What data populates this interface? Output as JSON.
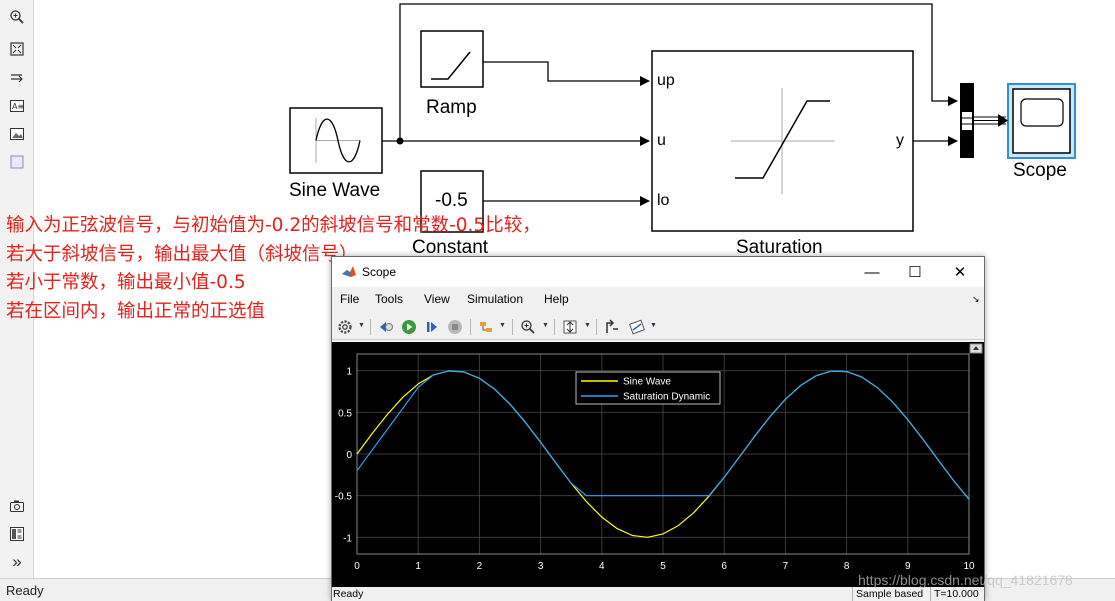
{
  "palette": {
    "items": [
      "zoom-icon",
      "fit-view-icon",
      "route-lines-icon",
      "annotation-icon",
      "image-icon",
      "area-icon"
    ],
    "bottom_items": [
      "camera-icon",
      "model-browser-icon",
      "expand-icon"
    ],
    "expand_glyph": "»"
  },
  "diagram": {
    "blocks": {
      "sine_wave": "Sine Wave",
      "ramp": "Ramp",
      "constant": "Constant",
      "constant_value": "-0.5",
      "saturation": "Saturation",
      "scope": "Scope"
    },
    "ports": {
      "up": "up",
      "u": "u",
      "lo": "lo",
      "y": "y"
    }
  },
  "annotation": {
    "lines": [
      "输入为正弦波信号，与初始值为-0.2的斜坡信号和常数-0.5比较，",
      "若大于斜坡信号，输出最大值（斜坡信号）",
      "若小于常数，输出最小值-0.5",
      "若在区间内，输出正常的正选值"
    ]
  },
  "status": {
    "text": "Ready"
  },
  "scope_window": {
    "title": "Scope",
    "controls": {
      "minimize": "—",
      "maximize": "☐",
      "close": "✕"
    },
    "menu": [
      "File",
      "Tools",
      "View",
      "Simulation",
      "Help"
    ],
    "toolbar": [
      "settings-icon",
      "step-back-icon",
      "run-icon",
      "step-forward-icon",
      "stop-icon",
      "highlight-icon",
      "zoom-icon",
      "autoscale-icon",
      "triggers-icon",
      "measurements-icon"
    ],
    "status": {
      "ready": "Ready",
      "sample": "Sample based",
      "time": "T=10.000"
    },
    "colors": {
      "sine": "#ffff00",
      "saturation": "#2fa2ff",
      "background": "#000000",
      "axes": "#ffffff"
    }
  },
  "chart_data": {
    "type": "line",
    "title": "",
    "xlabel": "",
    "ylabel": "",
    "xlim": [
      0,
      10
    ],
    "ylim": [
      -1.2,
      1.2
    ],
    "xticks": [
      0,
      1,
      2,
      3,
      4,
      5,
      6,
      7,
      8,
      9,
      10
    ],
    "yticks": [
      -1,
      -0.5,
      0,
      0.5,
      1
    ],
    "ytick_labels": [
      "-1",
      "-0.5",
      "0",
      "0.5",
      "1"
    ],
    "grid": true,
    "legend": "top-center",
    "series": [
      {
        "name": "Sine Wave",
        "color": "#ffff00",
        "x": [
          0,
          0.25,
          0.5,
          0.75,
          1,
          1.25,
          1.5,
          1.75,
          2,
          2.25,
          2.5,
          2.75,
          3,
          3.25,
          3.5,
          3.75,
          4,
          4.25,
          4.5,
          4.75,
          5,
          5.25,
          5.5,
          5.75,
          6,
          6.25,
          6.5,
          6.75,
          7,
          7.25,
          7.5,
          7.75,
          8,
          8.25,
          8.5,
          8.75,
          9,
          9.25,
          9.5,
          9.75,
          10
        ],
        "y": [
          0,
          0.247,
          0.479,
          0.682,
          0.841,
          0.949,
          0.997,
          0.984,
          0.909,
          0.778,
          0.598,
          0.382,
          0.141,
          -0.108,
          -0.351,
          -0.572,
          -0.757,
          -0.895,
          -0.978,
          -0.999,
          -0.959,
          -0.859,
          -0.706,
          -0.508,
          -0.279,
          -0.033,
          0.215,
          0.45,
          0.657,
          0.823,
          0.938,
          0.995,
          0.989,
          0.923,
          0.798,
          0.625,
          0.412,
          0.174,
          -0.075,
          -0.32,
          -0.544
        ]
      },
      {
        "name": "Saturation Dynamic",
        "color": "#2fa2ff",
        "x": [
          0,
          0.25,
          0.5,
          0.75,
          1,
          1.25,
          1.5,
          1.75,
          2,
          2.25,
          2.5,
          2.75,
          3,
          3.25,
          3.5,
          3.75,
          4,
          4.25,
          4.5,
          4.75,
          5,
          5.25,
          5.5,
          5.75,
          6,
          6.25,
          6.5,
          6.75,
          7,
          7.25,
          7.5,
          7.75,
          8,
          8.25,
          8.5,
          8.75,
          9,
          9.25,
          9.5,
          9.75,
          10
        ],
        "y": [
          -0.2,
          0.05,
          0.3,
          0.55,
          0.8,
          0.949,
          0.997,
          0.984,
          0.909,
          0.778,
          0.598,
          0.382,
          0.141,
          -0.108,
          -0.351,
          -0.5,
          -0.5,
          -0.5,
          -0.5,
          -0.5,
          -0.5,
          -0.5,
          -0.5,
          -0.5,
          -0.279,
          -0.033,
          0.215,
          0.45,
          0.657,
          0.823,
          0.938,
          0.995,
          0.989,
          0.923,
          0.798,
          0.625,
          0.412,
          0.174,
          -0.075,
          -0.32,
          -0.544
        ]
      }
    ]
  },
  "watermark": "https://blog.csdn.net/qq_41821678"
}
